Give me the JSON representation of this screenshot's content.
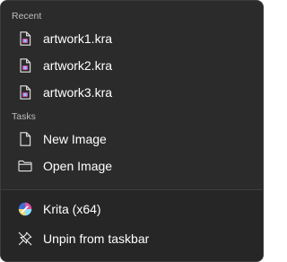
{
  "recent": {
    "header": "Recent",
    "items": [
      {
        "label": "artwork1.kra",
        "icon": "kra-file-icon"
      },
      {
        "label": "artwork2.kra",
        "icon": "kra-file-icon"
      },
      {
        "label": "artwork3.kra",
        "icon": "kra-file-icon"
      }
    ]
  },
  "tasks": {
    "header": "Tasks",
    "items": [
      {
        "label": "New Image",
        "icon": "new-document-icon"
      },
      {
        "label": "Open Image",
        "icon": "folder-icon"
      }
    ]
  },
  "app": {
    "label": "Krita (x64)",
    "icon": "krita-app-icon"
  },
  "unpin": {
    "label": "Unpin from taskbar",
    "icon": "unpin-icon"
  },
  "colors": {
    "background": "#2b2b2b",
    "lower_background": "#262626",
    "text": "#ffffff",
    "header_text": "#bdbdbd"
  }
}
